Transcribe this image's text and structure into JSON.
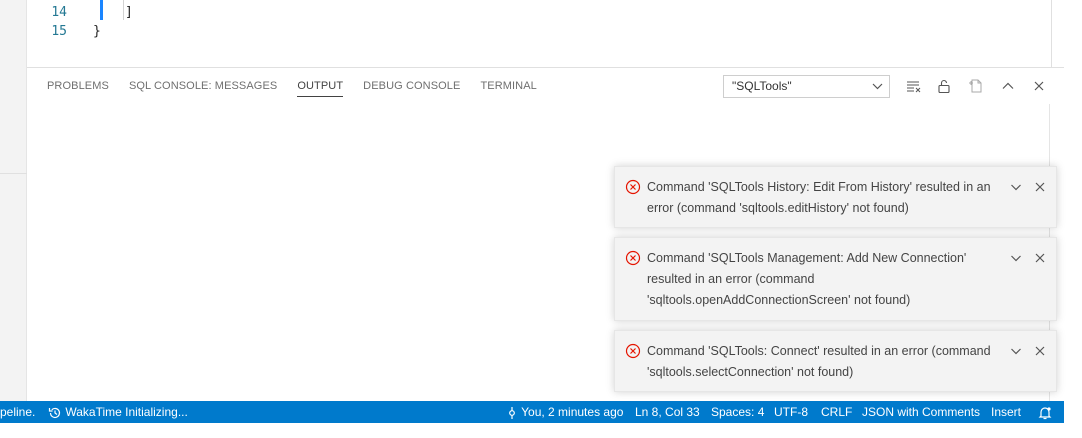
{
  "editor": {
    "lines": [
      {
        "number": "14",
        "code": "]"
      },
      {
        "number": "15",
        "code": "}"
      }
    ]
  },
  "panel": {
    "tabs": [
      "PROBLEMS",
      "SQL CONSOLE: MESSAGES",
      "OUTPUT",
      "DEBUG CONSOLE",
      "TERMINAL"
    ],
    "active_tab": "OUTPUT",
    "output_channel": "\"SQLTools\"",
    "icons": [
      "clear-output-icon",
      "lock-scroll-icon",
      "open-log-icon",
      "maximize-panel-icon",
      "close-panel-icon"
    ]
  },
  "notifications": [
    {
      "severity": "error",
      "message": "Command 'SQLTools History: Edit From History' resulted in an error (command 'sqltools.editHistory' not found)"
    },
    {
      "severity": "error",
      "message": "Command 'SQLTools Management: Add New Connection' resulted in an error (command 'sqltools.openAddConnectionScreen' not found)"
    },
    {
      "severity": "error",
      "message": "Command 'SQLTools: Connect' resulted in an error (command 'sqltools.selectConnection' not found)"
    }
  ],
  "statusbar": {
    "left_truncated": "peline.",
    "wakatime": "WakaTime Initializing...",
    "git_blame": "You, 2 minutes ago",
    "cursor": "Ln 8, Col 33",
    "spaces": "Spaces: 4",
    "encoding": "UTF-8",
    "eol": "CRLF",
    "language": "JSON with Comments",
    "mode": "Insert"
  },
  "colors": {
    "statusbar_bg": "#007acc",
    "error": "#e51400",
    "accent": "#1a85ff"
  }
}
